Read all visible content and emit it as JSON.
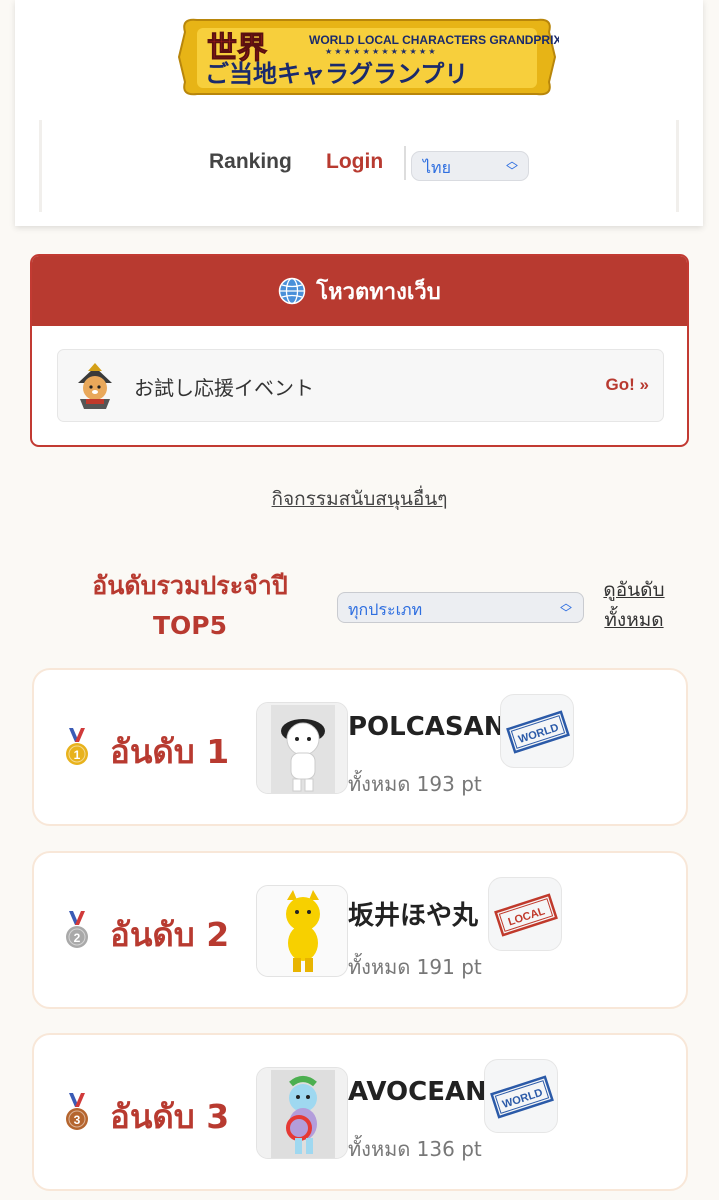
{
  "header": {
    "logo": {
      "kanji": "世界",
      "english": "WORLD LOCAL CHARACTERS GRANDPRIX",
      "japanese": "ご当地キャラグランプリ"
    },
    "nav": {
      "ranking": "Ranking",
      "login": "Login",
      "language": "ไทย"
    }
  },
  "vote": {
    "title": "โหวตทางเว็บ",
    "event_name": "お試し応援イベント",
    "go_label": "Go! »"
  },
  "other_activities": "กิจกรรมสนับสนุนอื่นๆ",
  "ranking": {
    "title_line1": "อันดับรวมประจำปี",
    "title_line2": "TOP5",
    "category": "ทุกประเภท",
    "see_all_line1": "ดูอันดับ",
    "see_all_line2": "ทั้งหมด",
    "items": [
      {
        "rank_label": "อันดับ 1",
        "medal_number": "1",
        "medal_color": "#e8b21c",
        "name": "POLCASAN",
        "points": "ทั้งหมด 193 pt",
        "badge": "WORLD",
        "badge_color": "#2b5aa8"
      },
      {
        "rank_label": "อันดับ 2",
        "medal_number": "2",
        "medal_color": "#a9a9a9",
        "name": "坂井ほや丸",
        "points": "ทั้งหมด 191 pt",
        "badge": "LOCAL",
        "badge_color": "#c0392b"
      },
      {
        "rank_label": "อันดับ 3",
        "medal_number": "3",
        "medal_color": "#b5652e",
        "name": "AVOCEAN",
        "points": "ทั้งหมด 136 pt",
        "badge": "WORLD",
        "badge_color": "#2b5aa8"
      }
    ]
  },
  "colors": {
    "accent": "#b83a30",
    "background": "#fbf9f5",
    "link_blue": "#2f6fe0"
  },
  "icons": [
    "globe-icon",
    "samurai-mascot-icon",
    "medal-icon",
    "chevron-updown-icon"
  ]
}
